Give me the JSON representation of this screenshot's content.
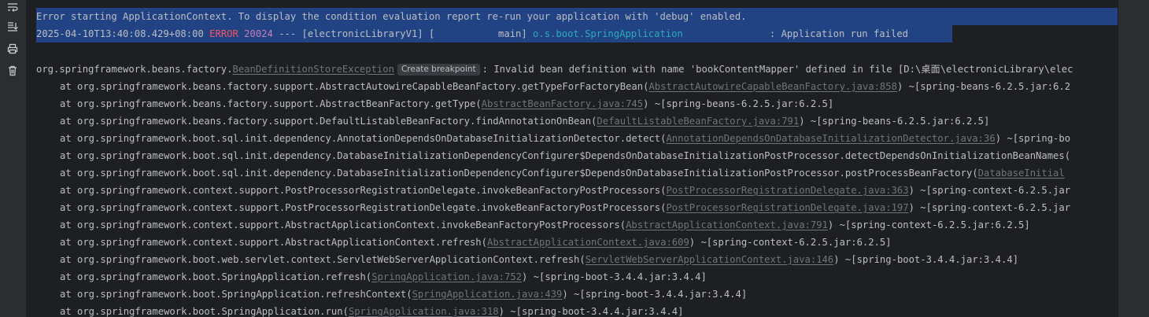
{
  "toolbar": {
    "icons": [
      "soft-wrap-icon",
      "scroll-to-end-icon",
      "print-icon",
      "clear-all-icon"
    ]
  },
  "colors": {
    "background": "#1e1f22",
    "selection": "#214283",
    "error": "#f75464",
    "pid": "#c77dbb",
    "logger": "#2aacb8",
    "link": "#6f737a",
    "text": "#bcbec4"
  },
  "header": {
    "line1": "Error starting ApplicationContext. To display the condition evaluation report re-run your application with 'debug' enabled.",
    "timestamp": "2025-04-10T13:40:08.429+08:00",
    "level": "ERROR",
    "pid": "20024",
    "separator": " --- [electronicLibraryV1] [           main] ",
    "logger": "o.s.boot.SpringApplication",
    "message": "               : Application run failed"
  },
  "exception": {
    "prefix": "org.springframework.beans.factory.",
    "class_link": "BeanDefinitionStoreException",
    "badge": "Create breakpoint",
    "message": ": Invalid bean definition with name 'bookContentMapper' defined in file [D:\\桌面\\electronicLibrary\\elec"
  },
  "stack": [
    {
      "method": "at org.springframework.beans.factory.support.AbstractAutowireCapableBeanFactory.getTypeForFactoryBean(",
      "file": "AbstractAutowireCapableBeanFactory.java:858",
      "tail": ") ~[spring-beans-6.2.5.jar:6.2"
    },
    {
      "method": "at org.springframework.beans.factory.support.AbstractBeanFactory.getType(",
      "file": "AbstractBeanFactory.java:745",
      "tail": ") ~[spring-beans-6.2.5.jar:6.2.5]"
    },
    {
      "method": "at org.springframework.beans.factory.support.DefaultListableBeanFactory.findAnnotationOnBean(",
      "file": "DefaultListableBeanFactory.java:791",
      "tail": ") ~[spring-beans-6.2.5.jar:6.2.5]"
    },
    {
      "method": "at org.springframework.boot.sql.init.dependency.AnnotationDependsOnDatabaseInitializationDetector.detect(",
      "file": "AnnotationDependsOnDatabaseInitializationDetector.java:36",
      "tail": ") ~[spring-bo"
    },
    {
      "method": "at org.springframework.boot.sql.init.dependency.DatabaseInitializationDependencyConfigurer$DependsOnDatabaseInitializationPostProcessor.detectDependsOnInitializationBeanNames(",
      "file": "",
      "tail": ""
    },
    {
      "method": "at org.springframework.boot.sql.init.dependency.DatabaseInitializationDependencyConfigurer$DependsOnDatabaseInitializationPostProcessor.postProcessBeanFactory(",
      "file": "DatabaseInitial",
      "tail": ""
    },
    {
      "method": "at org.springframework.context.support.PostProcessorRegistrationDelegate.invokeBeanFactoryPostProcessors(",
      "file": "PostProcessorRegistrationDelegate.java:363",
      "tail": ") ~[spring-context-6.2.5.jar"
    },
    {
      "method": "at org.springframework.context.support.PostProcessorRegistrationDelegate.invokeBeanFactoryPostProcessors(",
      "file": "PostProcessorRegistrationDelegate.java:197",
      "tail": ") ~[spring-context-6.2.5.jar"
    },
    {
      "method": "at org.springframework.context.support.AbstractApplicationContext.invokeBeanFactoryPostProcessors(",
      "file": "AbstractApplicationContext.java:791",
      "tail": ") ~[spring-context-6.2.5.jar:6.2.5]"
    },
    {
      "method": "at org.springframework.context.support.AbstractApplicationContext.refresh(",
      "file": "AbstractApplicationContext.java:609",
      "tail": ") ~[spring-context-6.2.5.jar:6.2.5]"
    },
    {
      "method": "at org.springframework.boot.web.servlet.context.ServletWebServerApplicationContext.refresh(",
      "file": "ServletWebServerApplicationContext.java:146",
      "tail": ") ~[spring-boot-3.4.4.jar:3.4.4]"
    },
    {
      "method": "at org.springframework.boot.SpringApplication.refresh(",
      "file": "SpringApplication.java:752",
      "tail": ") ~[spring-boot-3.4.4.jar:3.4.4]"
    },
    {
      "method": "at org.springframework.boot.SpringApplication.refreshContext(",
      "file": "SpringApplication.java:439",
      "tail": ") ~[spring-boot-3.4.4.jar:3.4.4]"
    },
    {
      "method": "at org.springframework.boot.SpringApplication.run(",
      "file": "SpringApplication.java:318",
      "tail": ") ~[spring-boot-3.4.4.jar:3.4.4]"
    }
  ]
}
